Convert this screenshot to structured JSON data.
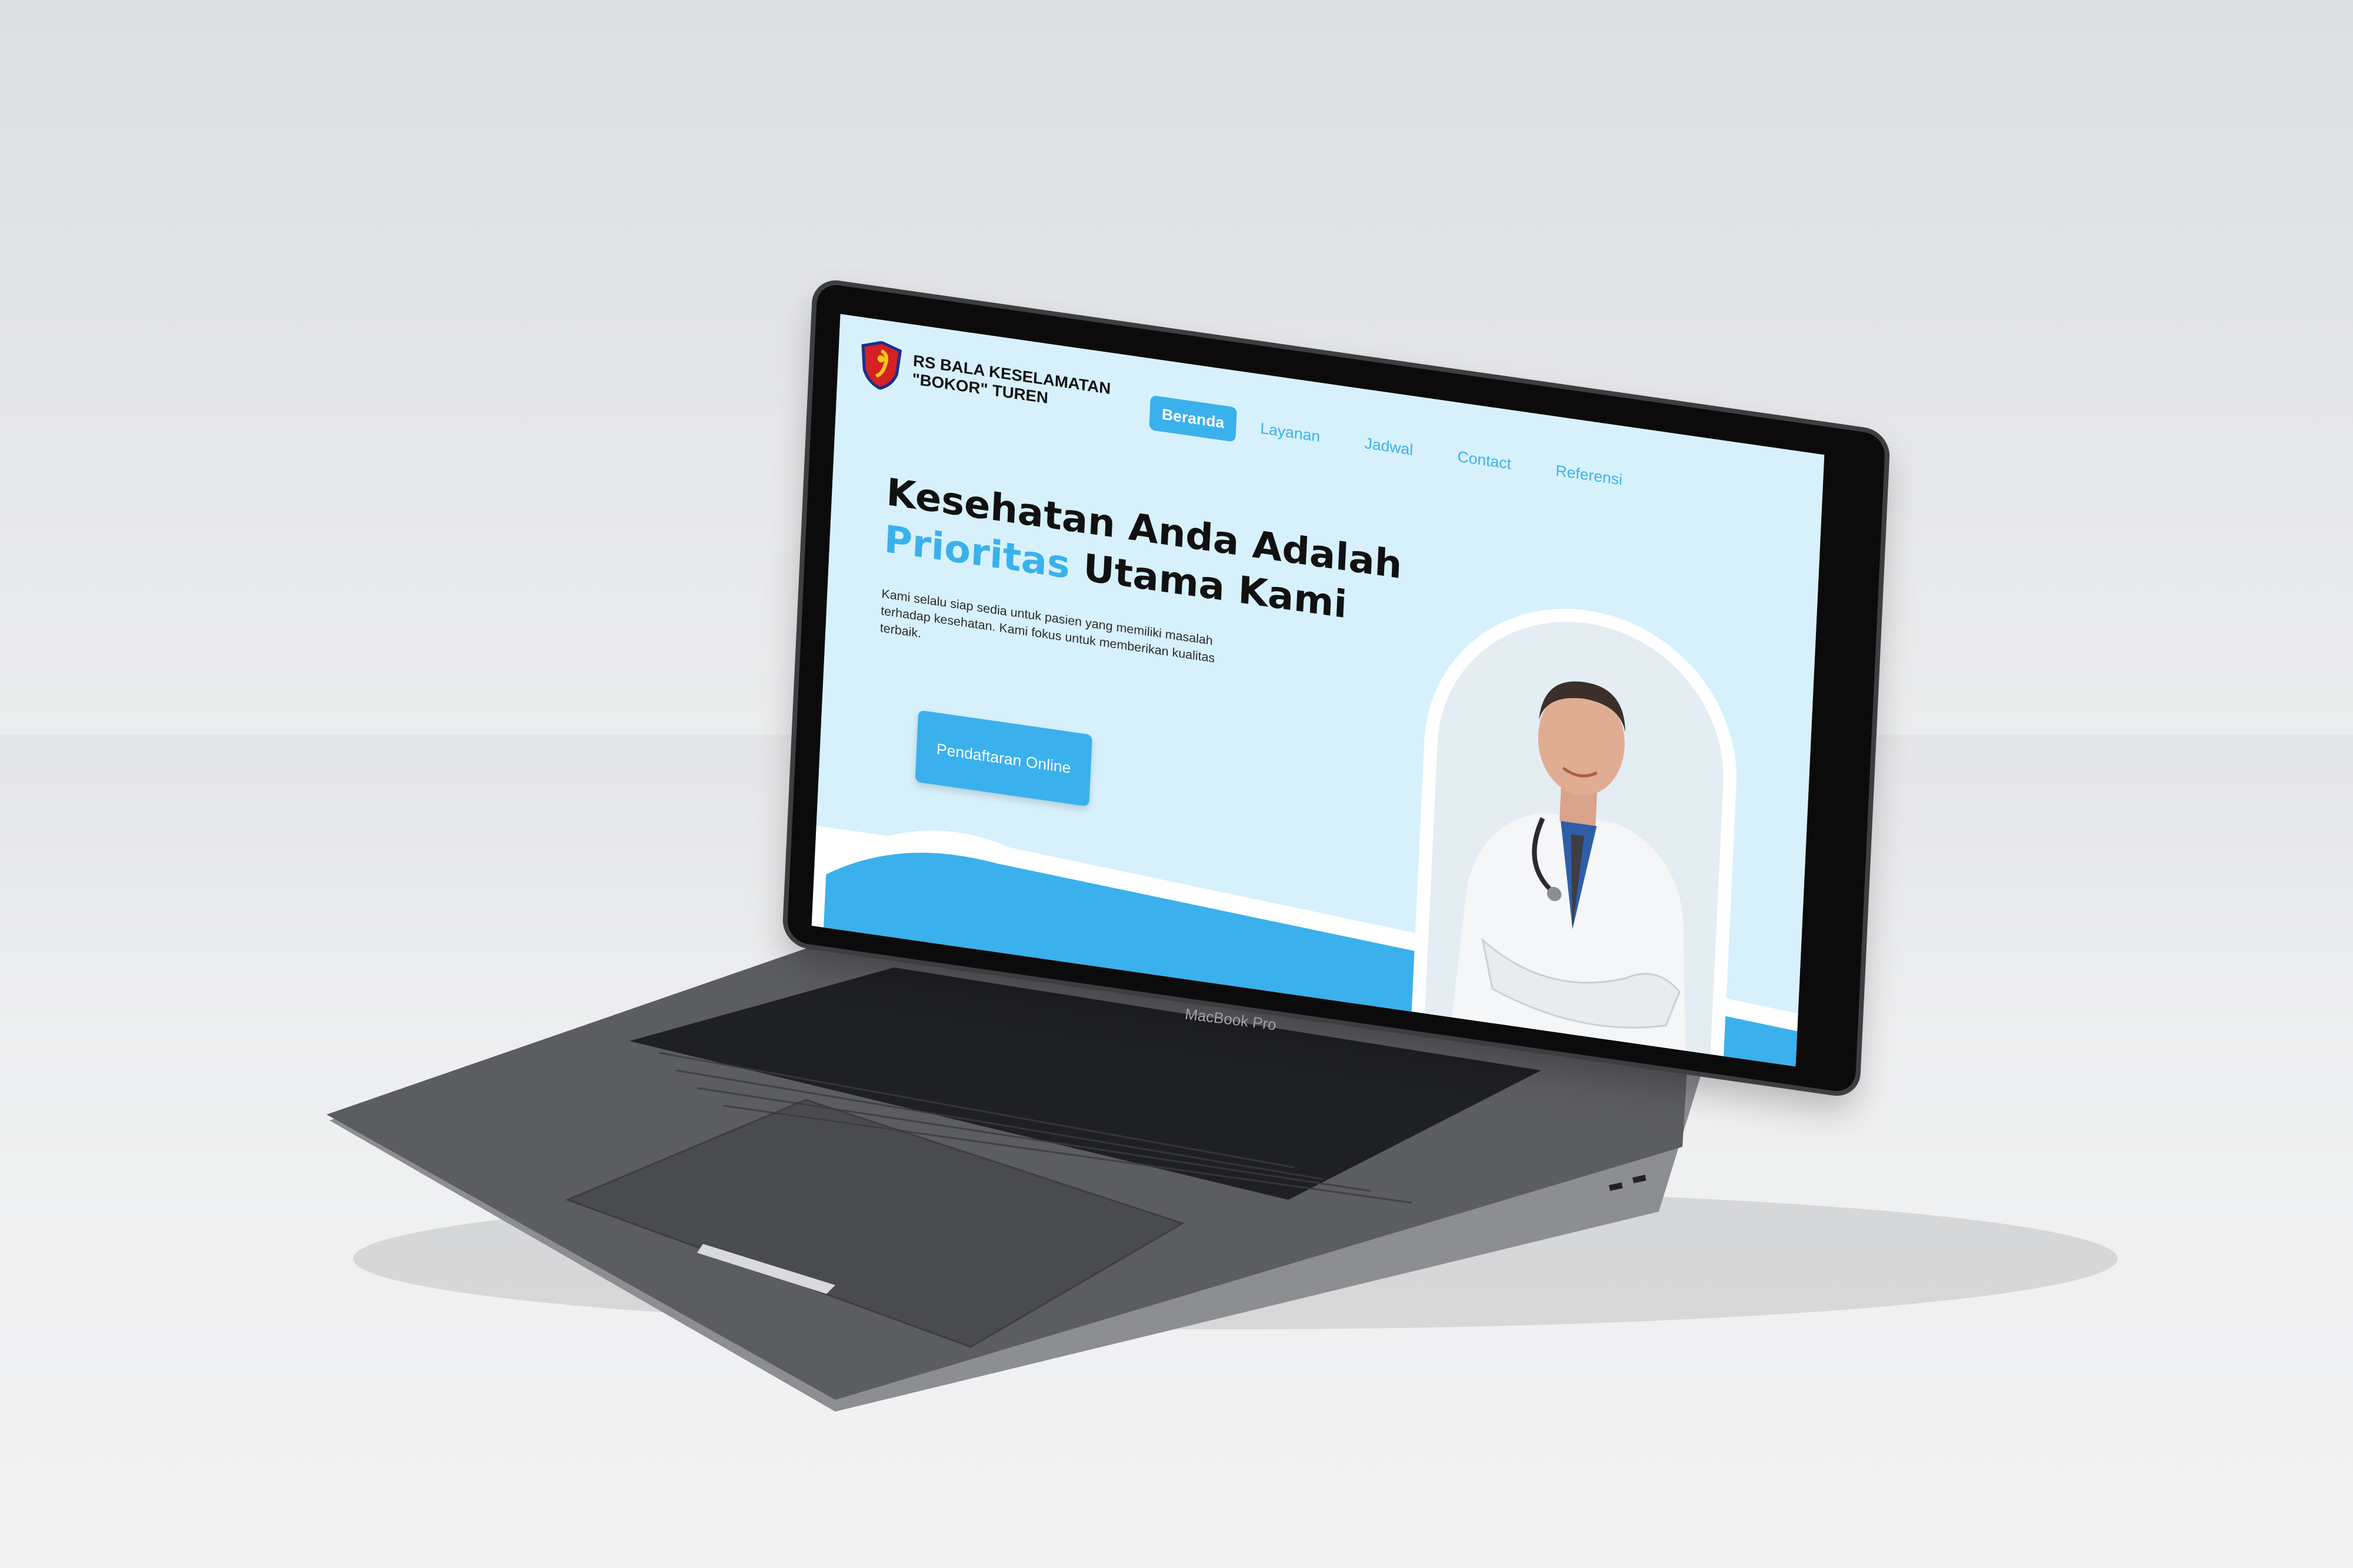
{
  "device": {
    "model_label": "MacBook Pro"
  },
  "site": {
    "brand": {
      "line1": "RS BALA KESELAMATAN",
      "line2": "\"BOKOR\" TUREN"
    },
    "nav": [
      {
        "label": "Beranda",
        "active": true
      },
      {
        "label": "Layanan",
        "active": false
      },
      {
        "label": "Jadwal",
        "active": false
      },
      {
        "label": "Contact",
        "active": false
      },
      {
        "label": "Referensi",
        "active": false
      }
    ],
    "hero": {
      "title_line1": "Kesehatan Anda Adalah",
      "title_accent": "Prioritas",
      "title_line2_rest": " Utama Kami",
      "description": "Kami selalu siap sedia untuk pasien yang memiliki masalah terhadap kesehatan. Kami fokus untuk memberikan kualitas terbaik.",
      "cta_label": "Pendaftaran Online"
    },
    "colors": {
      "accent": "#3ab1ec",
      "background": "#d7f1fc",
      "text": "#111111"
    }
  }
}
